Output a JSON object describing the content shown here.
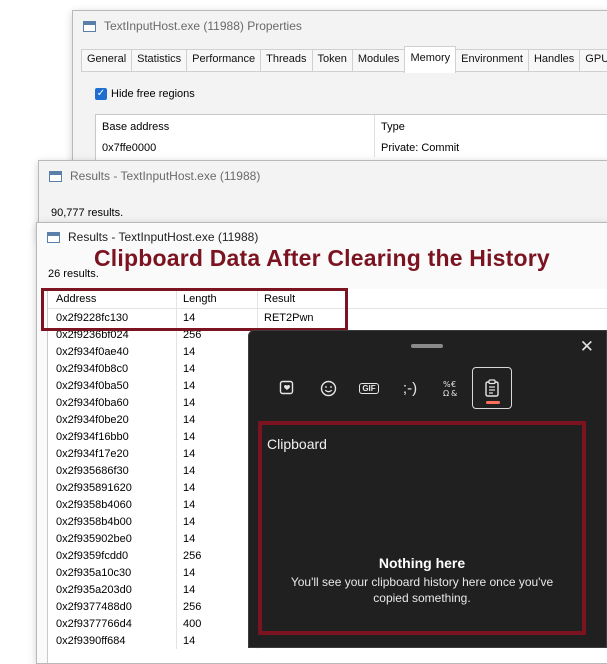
{
  "properties_window": {
    "title": "TextInputHost.exe (11988) Properties",
    "tabs": [
      "General",
      "Statistics",
      "Performance",
      "Threads",
      "Token",
      "Modules",
      "Memory",
      "Environment",
      "Handles",
      "GPU"
    ],
    "active_tab": "Memory",
    "hide_free_regions_label": "Hide free regions",
    "table_headers": [
      "Base address",
      "Type"
    ],
    "first_row": [
      "0x7ffe0000",
      "Private: Commit"
    ]
  },
  "results_window_1": {
    "title": "Results - TextInputHost.exe (11988)",
    "count": "90,777 results."
  },
  "results_window_2": {
    "title": "Results - TextInputHost.exe (11988)",
    "count": "26 results.",
    "headers": [
      "Address",
      "Length",
      "Result"
    ],
    "rows": [
      [
        "0x2f9228fc130",
        "14",
        "RET2Pwn"
      ],
      [
        "0x2f9236bf024",
        "256",
        ""
      ],
      [
        "0x2f934f0ae40",
        "14",
        ""
      ],
      [
        "0x2f934f0b8c0",
        "14",
        ""
      ],
      [
        "0x2f934f0ba50",
        "14",
        ""
      ],
      [
        "0x2f934f0ba60",
        "14",
        ""
      ],
      [
        "0x2f934f0be20",
        "14",
        ""
      ],
      [
        "0x2f934f16bb0",
        "14",
        ""
      ],
      [
        "0x2f934f17e20",
        "14",
        ""
      ],
      [
        "0x2f935686f30",
        "14",
        ""
      ],
      [
        "0x2f935891620",
        "14",
        ""
      ],
      [
        "0x2f9358b4060",
        "14",
        ""
      ],
      [
        "0x2f9358b4b00",
        "14",
        ""
      ],
      [
        "0x2f935902be0",
        "14",
        ""
      ],
      [
        "0x2f9359fcdd0",
        "256",
        ""
      ],
      [
        "0x2f935a10c30",
        "14",
        ""
      ],
      [
        "0x2f935a203d0",
        "14",
        ""
      ],
      [
        "0x2f9377488d0",
        "256",
        ""
      ],
      [
        "0x2f9377766d4",
        "400",
        ""
      ],
      [
        "0x2f9390ff684",
        "14",
        ""
      ]
    ]
  },
  "annotation": {
    "headline": "Clipboard Data After Clearing the History",
    "color": "#7b1420"
  },
  "clipboard_panel": {
    "close_label": "✕",
    "tab_icons": [
      "emoji-favorites-icon",
      "emoji-icon",
      "gif-icon",
      "kaomoji-icon",
      "symbols-icon",
      "clipboard-icon"
    ],
    "gif_label": "GIF",
    "kaomoji_label": ";-)",
    "section_title": "Clipboard",
    "empty_title": "Nothing here",
    "empty_message": "You'll see your clipboard history here once you've copied something."
  }
}
